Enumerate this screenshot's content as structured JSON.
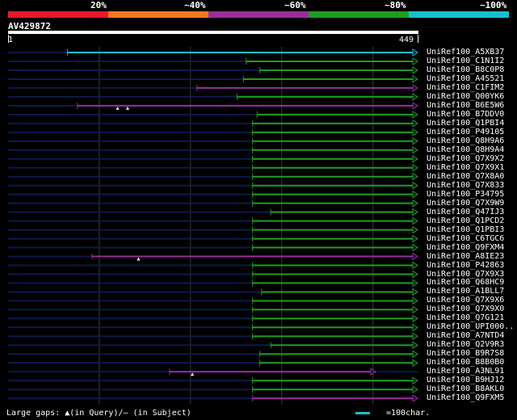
{
  "legend": {
    "segments": [
      {
        "color": "#e8192c"
      },
      {
        "color": "#f07820"
      },
      {
        "color": "#9b2d9b"
      },
      {
        "color": "#1e9e1e"
      },
      {
        "color": "#17c0cc"
      }
    ],
    "labels": [
      "20%",
      "~40%",
      "~60%",
      "~80%",
      "~100%"
    ]
  },
  "query": {
    "name": "AV429872",
    "start": "1",
    "end": "449",
    "length": 449
  },
  "colors": {
    "cyan": "#17c0cc",
    "green": "#1e9e1e",
    "purple": "#9b2d9b",
    "track": "#0d1a4d",
    "grid": "#3a3a3a"
  },
  "hits": [
    {
      "name": "UniRef100_A5XB37",
      "start": 65,
      "color": "cyan",
      "gaps": []
    },
    {
      "name": "UniRef100_C1N1I2",
      "start": 261,
      "color": "green",
      "gaps": []
    },
    {
      "name": "UniRef100_B8C0P8",
      "start": 276,
      "color": "green",
      "gaps": []
    },
    {
      "name": "UniRef100_A4S521",
      "start": 258,
      "color": "green",
      "gaps": []
    },
    {
      "name": "UniRef100_C1FIM2",
      "start": 207,
      "color": "purple",
      "gaps": []
    },
    {
      "name": "UniRef100_Q00YK6",
      "start": 251,
      "color": "green",
      "gaps": []
    },
    {
      "name": "UniRef100_B6E5W6",
      "start": 76,
      "color": "purple",
      "gaps": [
        120,
        131
      ]
    },
    {
      "name": "UniRef100_B7DDV0",
      "start": 273,
      "color": "green",
      "gaps": []
    },
    {
      "name": "UniRef100_Q1PBI4",
      "start": 268,
      "color": "green",
      "gaps": []
    },
    {
      "name": "UniRef100_P49105",
      "start": 268,
      "color": "green",
      "gaps": []
    },
    {
      "name": "UniRef100_Q8H9A6",
      "start": 268,
      "color": "green",
      "gaps": []
    },
    {
      "name": "UniRef100_Q8H9A4",
      "start": 268,
      "color": "green",
      "gaps": []
    },
    {
      "name": "UniRef100_Q7X9X2",
      "start": 268,
      "color": "green",
      "gaps": []
    },
    {
      "name": "UniRef100_Q7X9X1",
      "start": 268,
      "color": "green",
      "gaps": []
    },
    {
      "name": "UniRef100_Q7X8A0",
      "start": 268,
      "color": "green",
      "gaps": []
    },
    {
      "name": "UniRef100_Q7X833",
      "start": 268,
      "color": "green",
      "gaps": []
    },
    {
      "name": "UniRef100_P34795",
      "start": 268,
      "color": "green",
      "gaps": []
    },
    {
      "name": "UniRef100_Q7X9W9",
      "start": 268,
      "color": "green",
      "gaps": []
    },
    {
      "name": "UniRef100_Q47IJ3",
      "start": 288,
      "color": "green",
      "gaps": []
    },
    {
      "name": "UniRef100_Q1PCD2",
      "start": 268,
      "color": "green",
      "gaps": []
    },
    {
      "name": "UniRef100_Q1PBI3",
      "start": 268,
      "color": "green",
      "gaps": []
    },
    {
      "name": "UniRef100_C6TGC6",
      "start": 268,
      "color": "green",
      "gaps": []
    },
    {
      "name": "UniRef100_Q9FXM4",
      "start": 268,
      "color": "green",
      "gaps": []
    },
    {
      "name": "UniRef100_A8IE23",
      "start": 92,
      "color": "purple",
      "gaps": [
        143
      ]
    },
    {
      "name": "UniRef100_P42863",
      "start": 268,
      "color": "green",
      "gaps": []
    },
    {
      "name": "UniRef100_Q7X9X3",
      "start": 268,
      "color": "green",
      "gaps": []
    },
    {
      "name": "UniRef100_Q68HC9",
      "start": 268,
      "color": "green",
      "gaps": []
    },
    {
      "name": "UniRef100_A1BLL7",
      "start": 278,
      "color": "green",
      "gaps": []
    },
    {
      "name": "UniRef100_Q7X9X6",
      "start": 268,
      "color": "green",
      "gaps": []
    },
    {
      "name": "UniRef100_Q7X9X0",
      "start": 268,
      "color": "green",
      "gaps": []
    },
    {
      "name": "UniRef100_Q7G121",
      "start": 268,
      "color": "green",
      "gaps": []
    },
    {
      "name": "UniRef100_UPI000..",
      "start": 268,
      "color": "green",
      "gaps": []
    },
    {
      "name": "UniRef100_A7NTD4",
      "start": 268,
      "color": "green",
      "gaps": []
    },
    {
      "name": "UniRef100_Q2V9R3",
      "start": 288,
      "color": "green",
      "gaps": []
    },
    {
      "name": "UniRef100_B9R7S8",
      "start": 276,
      "color": "green",
      "gaps": []
    },
    {
      "name": "UniRef100_B8B0B0",
      "start": 276,
      "color": "green",
      "gaps": []
    },
    {
      "name": "UniRef100_A3NL91",
      "start": 177,
      "end": 403,
      "color": "purple",
      "gaps": [
        202
      ]
    },
    {
      "name": "UniRef100_B9HJ12",
      "start": 268,
      "color": "green",
      "gaps": []
    },
    {
      "name": "UniRef100_B8AKL0",
      "start": 268,
      "color": "green",
      "gaps": []
    },
    {
      "name": "UniRef100_Q9FXM5",
      "start": 268,
      "color": "purple",
      "gaps": []
    }
  ],
  "gridlines": [
    100,
    200,
    300,
    400
  ],
  "footer": {
    "left": "Large gaps: ▲(in Query)/— (in Subject)",
    "right": "=100char."
  }
}
